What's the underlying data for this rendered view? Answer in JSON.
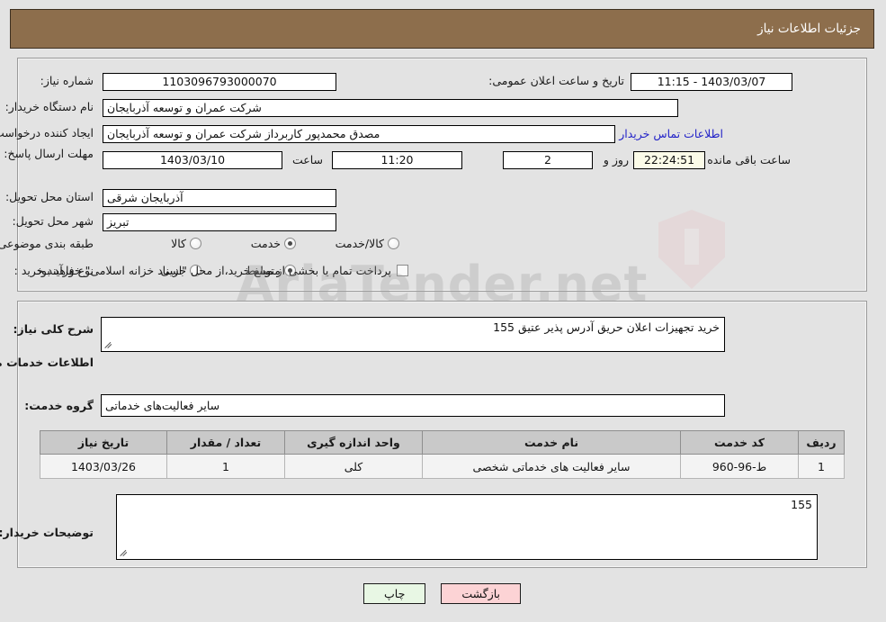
{
  "header": {
    "title": "جزئیات اطلاعات نیاز"
  },
  "form": {
    "need_number_label": "شماره نیاز:",
    "need_number_value": "1103096793000070",
    "announce_datetime_label": "تاریخ و ساعت اعلان عمومی:",
    "announce_datetime_value": "1403/03/07 - 11:15",
    "buyer_org_label": "نام دستگاه خریدار:",
    "buyer_org_value": "شرکت عمران و توسعه آذربایجان",
    "creator_label": "ایجاد کننده درخواست:",
    "creator_value": "مصدق محمدپور کاربرداز شرکت عمران و توسعه آذربایجان",
    "contact_link": "اطلاعات تماس خریدار",
    "deadline_label": "مهلت ارسال پاسخ: تا تاریخ:",
    "deadline_date": "1403/03/10",
    "hour_label": "ساعت",
    "deadline_time": "11:20",
    "days_value": "2",
    "days_label": "روز و",
    "countdown_value": "22:24:51",
    "countdown_label": "ساعت باقی مانده",
    "province_label": "استان محل تحویل:",
    "province_value": "آذربایجان شرقی",
    "city_label": "شهر محل تحویل:",
    "city_value": "تبریز",
    "category_label": "طبقه بندی موضوعی:",
    "category_options": [
      {
        "label": "کالا",
        "selected": false
      },
      {
        "label": "خدمت",
        "selected": true
      },
      {
        "label": "کالا/خدمت",
        "selected": false
      }
    ],
    "process_label": "نوع فرآیند خرید :",
    "process_options": [
      {
        "label": "جزیی",
        "selected": false
      },
      {
        "label": "متوسط",
        "selected": true
      }
    ],
    "treasury_checkbox_text": "پرداخت تمام یا بخشی از مبلغ خرید،از محل \"اسناد خزانه اسلامی\" خواهد بود.",
    "treasury_checked": false
  },
  "details": {
    "need_summary_label": "شرح کلی نیاز:",
    "need_summary_value": "خرید تجهیزات اعلان حریق آدرس پذیر عتیق 155",
    "services_section_title": "اطلاعات خدمات مورد نیاز",
    "service_group_label": "گروه خدمت:",
    "service_group_value": "سایر فعالیت‌های خدماتی",
    "buyer_notes_label": "توضیحات خریدار:",
    "buyer_notes_value": "155"
  },
  "table": {
    "headers": [
      "ردیف",
      "کد خدمت",
      "نام خدمت",
      "واحد اندازه گیری",
      "تعداد / مقدار",
      "تاریخ نیاز"
    ],
    "rows": [
      {
        "index": "1",
        "code": "ط-96-960",
        "name": "سایر فعالیت های خدماتی شخصی",
        "unit": "کلی",
        "quantity": "1",
        "need_date": "1403/03/26"
      }
    ]
  },
  "footer": {
    "print_label": "چاپ",
    "back_label": "بازگشت"
  },
  "watermark": {
    "text": "AriaTender.net"
  },
  "colors": {
    "header_bg": "#8d6e4c",
    "page_bg": "#e3e3e3",
    "link": "#2323c8",
    "btn_back": "#fcd3d5",
    "btn_print": "#e8f7e4",
    "countdown_bg": "#fbfbe8",
    "table_header_bg": "#c9c9c9"
  }
}
